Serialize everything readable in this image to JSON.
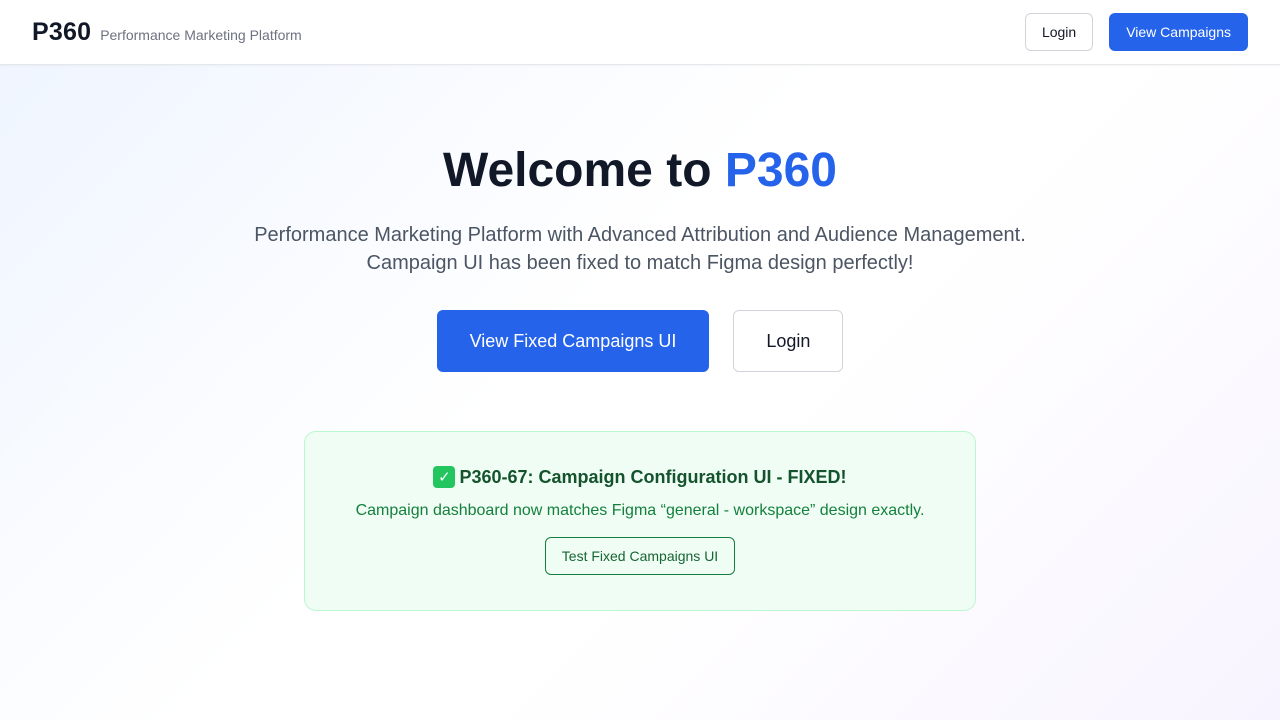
{
  "header": {
    "logo": "P360",
    "tagline": "Performance Marketing Platform",
    "login_label": "Login",
    "view_campaigns_label": "View Campaigns"
  },
  "hero": {
    "title_prefix": "Welcome to ",
    "title_accent": "P360",
    "subtitle_line1": "Performance Marketing Platform with Advanced Attribution and Audience Management.",
    "subtitle_line2": "Campaign UI has been fixed to match Figma design perfectly!",
    "primary_button": "View Fixed Campaigns UI",
    "secondary_button": "Login"
  },
  "notice": {
    "icon": "check-mark-icon",
    "title": "P360-67: Campaign Configuration UI - FIXED!",
    "text": "Campaign dashboard now matches Figma “general - workspace” design exactly.",
    "button": "Test Fixed Campaigns UI"
  },
  "colors": {
    "primary": "#2563eb",
    "success_bg": "#f0fdf4",
    "success_border": "#bbf7d0",
    "success_text": "#15803d"
  }
}
